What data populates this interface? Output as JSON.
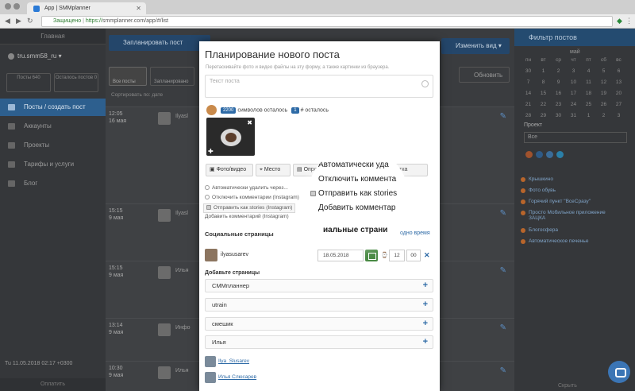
{
  "browser": {
    "tab_title": "App | SMMplanner",
    "secure_label": "Защищено",
    "url_scheme": "https://",
    "url_rest": "smmplanner.com/app/#/list"
  },
  "sidebar": {
    "header": "Главная",
    "account": "tru.smm58_ru",
    "stat_left": "Посты 640",
    "stat_right": "Осталось постов 0",
    "nav": [
      {
        "label": "Посты / создать пост",
        "active": true
      },
      {
        "label": "Аккаунты",
        "active": false
      },
      {
        "label": "Проекты",
        "active": false
      },
      {
        "label": "Тарифы и услуги",
        "active": false
      },
      {
        "label": "Блог",
        "active": false
      }
    ],
    "date_line": "Tu  11.05.2018  02:17  +0300",
    "footer": "Оплатить"
  },
  "toolbar": {
    "schedule_button": "Запланировать пост",
    "change_view_button": "Изменить вид",
    "refresh_button": "Обновить",
    "tab_all_posts": "Все посты",
    "tab_scheduled": "Запланировано",
    "sort_hint": "Сортировать по: дате"
  },
  "feed": {
    "posts": [
      {
        "time": "12:05",
        "day": "16 мая",
        "name": "Ilyasl"
      },
      {
        "time": "15:15",
        "day": "9 мая",
        "name": "Ilyasl"
      },
      {
        "time": "15:15",
        "day": "9 мая",
        "name": "Илья"
      },
      {
        "time": "13:14",
        "day": "9 мая",
        "name": "Инфо"
      },
      {
        "time": "10:30",
        "day": "9 мая",
        "name": "Илья"
      }
    ]
  },
  "right_panel": {
    "header": "Фильтр постов",
    "month_label": "май",
    "weekdays": [
      "пн",
      "вт",
      "ср",
      "чт",
      "пт",
      "сб",
      "вс"
    ],
    "weeks": [
      [
        "30",
        "1",
        "2",
        "3",
        "4",
        "5",
        "6"
      ],
      [
        "7",
        "8",
        "9",
        "10",
        "11",
        "12",
        "13"
      ],
      [
        "14",
        "15",
        "16",
        "17",
        "18",
        "19",
        "20"
      ],
      [
        "21",
        "22",
        "23",
        "24",
        "25",
        "26",
        "27"
      ],
      [
        "28",
        "29",
        "30",
        "31",
        "1",
        "2",
        "3"
      ]
    ],
    "project_label": "Проект",
    "project_value": "Все",
    "projects": [
      "Крышкино",
      "Фото обувь",
      "Горячий пункт \"ВсеСразу\"",
      "Просто Мобильное приложение ЗАЦКА",
      "Блогосфера",
      "Автоматическое печенье"
    ],
    "footer": "Скрыть"
  },
  "modal": {
    "title": "Планирование нового поста",
    "hint": "Перетаскивайте фото и видео файлы на эту форму, а также картинки из браузера.",
    "text_placeholder": "Текст поста",
    "chars_count": "2200",
    "chars_label": "символов осталось",
    "tags_count": "1",
    "tags_label": "# осталось",
    "buttons": [
      "Фото/видео",
      "Место",
      "Опрос",
      "Отметка"
    ],
    "options": [
      "Автоматически удалить через...",
      "Отключить комментарии (Instagram)",
      "Отправить как stories (Instagram)",
      "Добавить комментарий (Instagram)"
    ],
    "social_title": "Социальные страницы",
    "one_time_link": "одно время",
    "selected_account": "ilyasusarev",
    "date_value": "18.05.2018",
    "hour_value": "12",
    "minute_value": "00",
    "add_pages_title": "Добавьте страницы",
    "pages": [
      "СММпланнер",
      "utrain",
      "смешик",
      "Илья"
    ],
    "users": [
      "Ilya_Slusarev",
      "Илья Слюсарев"
    ]
  },
  "zoom": {
    "lines": [
      "Автоматически уда",
      "Отключить коммента",
      "Отправить как stories",
      "Добавить комментар",
      "иальные страни"
    ]
  }
}
